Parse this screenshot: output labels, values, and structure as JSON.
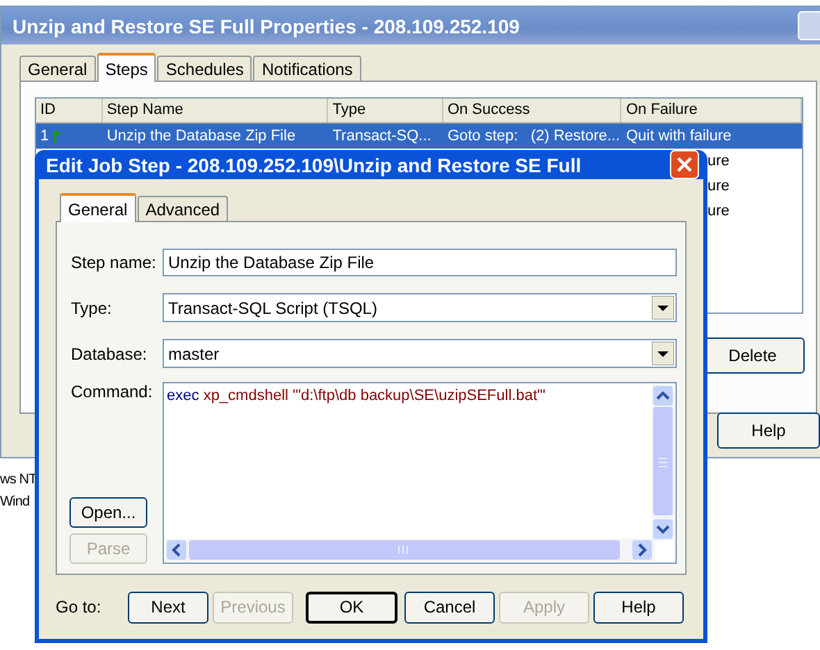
{
  "main_window": {
    "title": "Unzip and Restore SE Full Properties - 208.109.252.109",
    "tabs": [
      {
        "label": "General",
        "selected": false
      },
      {
        "label": "Steps",
        "selected": true
      },
      {
        "label": "Schedules",
        "selected": false
      },
      {
        "label": "Notifications",
        "selected": false
      }
    ],
    "steps_table": {
      "columns": [
        "ID",
        "Step Name",
        "Type",
        "On Success",
        "On Failure"
      ],
      "rows": [
        {
          "selected": true,
          "cells": [
            "1",
            "Unzip the Database Zip File",
            "Transact-SQ...",
            "Goto step:   (2) Restore...",
            "Quit with failure"
          ]
        },
        {
          "selected": false,
          "on_failure_tail": "ure"
        },
        {
          "selected": false,
          "on_failure_tail": "ure"
        },
        {
          "selected": false,
          "on_failure_tail": "ure"
        }
      ]
    },
    "buttons": [
      "Delete",
      "Help"
    ]
  },
  "desktop_labels": [
    "ws NT",
    "Wind"
  ],
  "dialog": {
    "title": "Edit Job Step - 208.109.252.109\\Unzip and Restore SE Full",
    "tabs": [
      {
        "label": "General",
        "selected": true
      },
      {
        "label": "Advanced",
        "selected": false
      }
    ],
    "fields": [
      {
        "kind": "text",
        "label": "Step name:",
        "value": "Unzip the Database Zip File"
      },
      {
        "kind": "dropdown",
        "label": "Type:",
        "value": "Transact-SQL Script (TSQL)"
      },
      {
        "kind": "dropdown",
        "label": "Database:",
        "value": "master"
      }
    ],
    "command": {
      "label": "Command:",
      "tokens": [
        {
          "text": "exec",
          "color": "#000080"
        },
        {
          "text": "xp_cmdshell '\"d:\\ftp\\db backup\\SE\\uzipSEFull.bat\"'",
          "color": "#800000"
        }
      ]
    },
    "side_buttons": [
      {
        "label": "Open...",
        "disabled": false
      },
      {
        "label": "Parse",
        "disabled": true
      }
    ],
    "goto_label": "Go to:",
    "buttons": [
      {
        "label": "Next",
        "disabled": false,
        "default": false
      },
      {
        "label": "Previous",
        "disabled": true,
        "default": false
      },
      {
        "label": "OK",
        "disabled": false,
        "default": true
      },
      {
        "label": "Cancel",
        "disabled": false,
        "default": false
      },
      {
        "label": "Apply",
        "disabled": true,
        "default": false
      },
      {
        "label": "Help",
        "disabled": false,
        "default": false
      }
    ]
  }
}
